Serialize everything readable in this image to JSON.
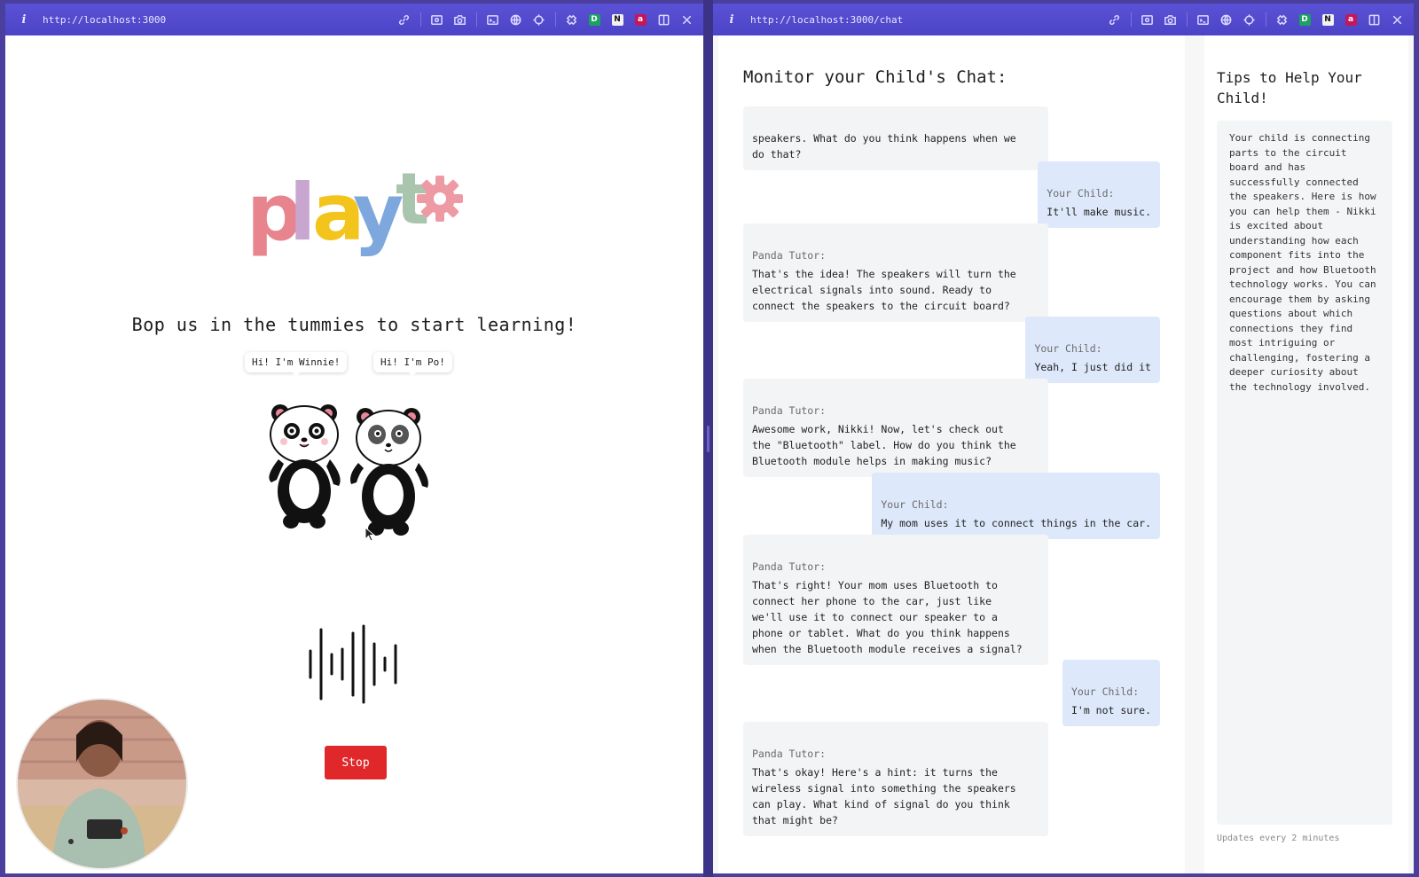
{
  "left": {
    "url": "http://localhost:3000",
    "logo_text": "playt",
    "headline": "Bop us in the tummies to start learning!",
    "bubble_winnie": "Hi! I'm Winnie!",
    "bubble_po": "Hi! I'm Po!",
    "stop_label": "Stop"
  },
  "right": {
    "url": "http://localhost:3000/chat",
    "chat_title": "Monitor your Child's Chat:",
    "messages": [
      {
        "who": "",
        "text": "speakers. What do you think happens when we\ndo that?"
      },
      {
        "who": "Your Child:",
        "text": "It'll make music."
      },
      {
        "who": "Panda Tutor:",
        "text": "That's the idea! The speakers will turn the\nelectrical signals into sound. Ready to\nconnect the speakers to the circuit board?"
      },
      {
        "who": "Your Child:",
        "text": "Yeah, I just did it"
      },
      {
        "who": "Panda Tutor:",
        "text": "Awesome work, Nikki! Now, let's check out\nthe \"Bluetooth\" label. How do you think the\nBluetooth module helps in making music?"
      },
      {
        "who": "Your Child:",
        "text": "My mom uses it to connect things in the car."
      },
      {
        "who": "Panda Tutor:",
        "text": "That's right! Your mom uses Bluetooth to\nconnect her phone to the car, just like\nwe'll use it to connect our speaker to a\nphone or tablet. What do you think happens\nwhen the Bluetooth module receives a signal?"
      },
      {
        "who": "Your Child:",
        "text": "I'm not sure."
      },
      {
        "who": "Panda Tutor:",
        "text": "That's okay! Here's a hint: it turns the\nwireless signal into something the speakers\ncan play. What kind of signal do you think\nthat might be?"
      }
    ],
    "tips_title": "Tips to Help Your Child!",
    "tips_body": "Your child is connecting parts to the circuit board and has successfully connected the speakers. Here is how you can help them - Nikki is excited about understanding how each component fits into the project and how Bluetooth technology works. You can encourage them by asking questions about which connections they find most intriguing or challenging, fostering a deeper curiosity about the technology involved.",
    "tips_footer": "Updates every 2 minutes"
  },
  "toolbar_icons": [
    "info-icon",
    "link-icon",
    "screenshot-icon",
    "camera-icon",
    "terminal-icon",
    "globe-icon",
    "crosshair-icon",
    "extensions-icon",
    "ext-green-icon",
    "ext-n-icon",
    "ext-pink-icon",
    "split-view-icon",
    "close-icon"
  ],
  "colors": {
    "toolbar": "#5a51d6",
    "stop": "#e0282b",
    "child_bubble": "#dde9fb",
    "tutor_bubble": "#f3f4f6"
  }
}
